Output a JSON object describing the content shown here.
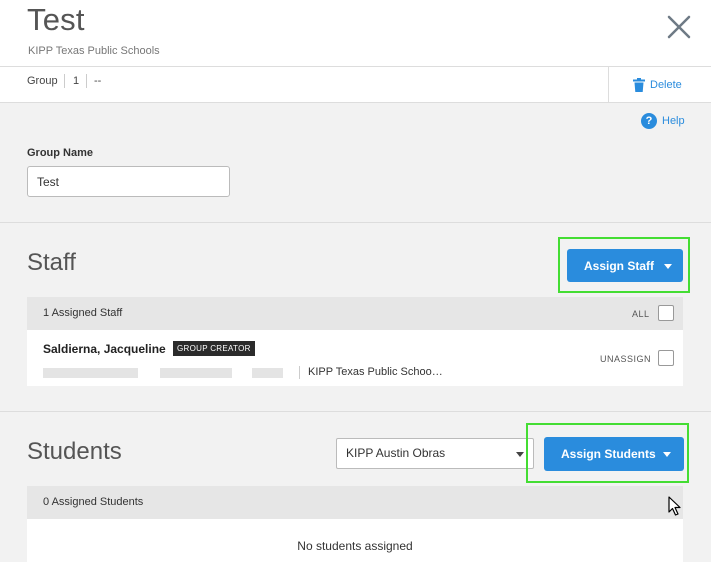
{
  "header": {
    "title": "Test",
    "subtitle": "KIPP Texas Public Schools"
  },
  "meta": {
    "group_label": "Group",
    "group_value": "1",
    "extra_value": "--",
    "delete_label": "Delete"
  },
  "help_label": "Help",
  "form": {
    "group_name_label": "Group Name",
    "group_name_value": "Test"
  },
  "staff": {
    "title": "Staff",
    "assign_button": "Assign Staff",
    "count_label": "1 Assigned Staff",
    "all_label": "ALL",
    "members": [
      {
        "name": "Saldierna, Jacqueline",
        "badge": "GROUP CREATOR",
        "school": "KIPP Texas Public Schoo…",
        "unassign_label": "UNASSIGN"
      }
    ]
  },
  "students": {
    "title": "Students",
    "school_select": "KIPP Austin Obras",
    "assign_button": "Assign Students",
    "count_label": "0 Assigned Students",
    "empty_message": "No students assigned"
  },
  "colors": {
    "accent": "#2a8cdd",
    "highlight": "#44dd33",
    "badge_bg": "#2b2b2b"
  }
}
